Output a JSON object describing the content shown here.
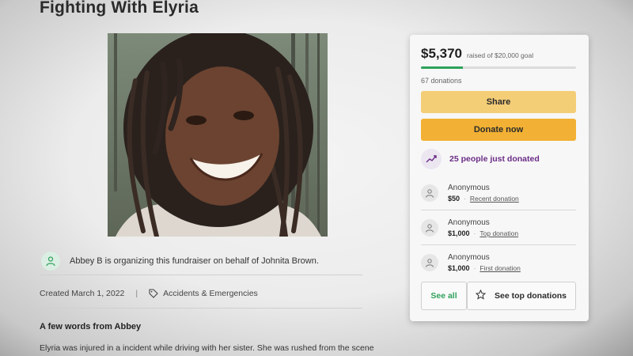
{
  "page": {
    "title": "Fighting With Elyria"
  },
  "organizer": {
    "icon": "user-heart-icon",
    "text": "Abbey B is organizing this fundraiser on behalf of Johnita Brown."
  },
  "meta": {
    "created": "Created March 1, 2022",
    "category_icon": "tag-icon",
    "category": "Accidents & Emergencies"
  },
  "story": {
    "heading": "A few words from Abbey",
    "text": "Elyria was injured in a incident while driving with her sister. She was rushed from the scene"
  },
  "donation_card": {
    "raised": "$5,370",
    "goal_text": "raised of $20,000 goal",
    "progress_fraction": 0.27,
    "progress_color": "#2ea15a",
    "donations_count": "67 donations",
    "share_label": "Share",
    "donate_label": "Donate now",
    "just_donated": {
      "icon": "trending-up-icon",
      "text": "25 people just donated",
      "color": "#6b2c86"
    },
    "donors": [
      {
        "name": "Anonymous",
        "amount": "$50",
        "type": "Recent donation"
      },
      {
        "name": "Anonymous",
        "amount": "$1,000",
        "type": "Top donation"
      },
      {
        "name": "Anonymous",
        "amount": "$1,000",
        "type": "First donation"
      }
    ],
    "see_all_label": "See all",
    "see_top_label": "See top donations",
    "see_top_icon": "star-icon"
  },
  "colors": {
    "share_button": "#f4cd77",
    "donate_button": "#f2b134",
    "accent_green": "#2ea15a"
  }
}
